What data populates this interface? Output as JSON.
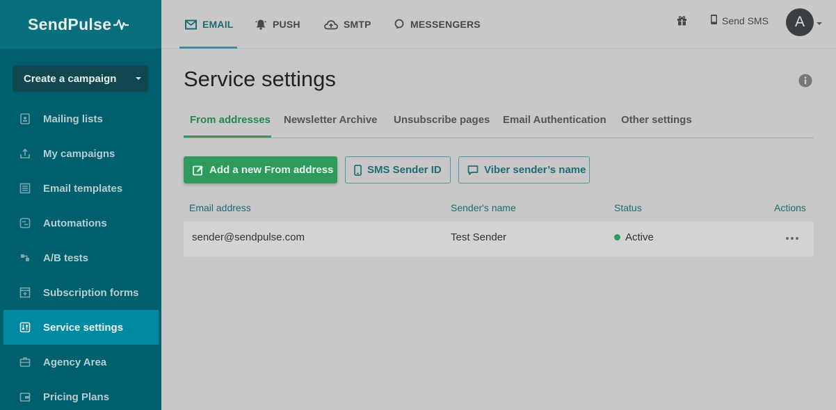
{
  "brand": {
    "name": "SendPulse"
  },
  "sidebar": {
    "create_label": "Create a campaign",
    "items": [
      {
        "label": "Mailing lists",
        "icon": "address-book-icon"
      },
      {
        "label": "My campaigns",
        "icon": "send-tray-icon"
      },
      {
        "label": "Email templates",
        "icon": "template-icon"
      },
      {
        "label": "Automations",
        "icon": "automation-icon"
      },
      {
        "label": "A/B tests",
        "icon": "ab-test-icon"
      },
      {
        "label": "Subscription forms",
        "icon": "form-icon"
      },
      {
        "label": "Service settings",
        "icon": "sliders-icon",
        "active": true
      },
      {
        "label": "Agency Area",
        "icon": "briefcase-icon"
      },
      {
        "label": "Pricing Plans",
        "icon": "wallet-icon"
      }
    ]
  },
  "topnav": {
    "tabs": [
      {
        "label": "EMAIL",
        "icon": "envelope-icon",
        "active": true
      },
      {
        "label": "PUSH",
        "icon": "bell-icon"
      },
      {
        "label": "SMTP",
        "icon": "cloud-upload-icon"
      },
      {
        "label": "MESSENGERS",
        "icon": "chat-bubble-icon"
      }
    ],
    "send_sms_label": "Send SMS",
    "avatar_initial": "A"
  },
  "page": {
    "title": "Service settings",
    "subtabs": [
      {
        "label": "From addresses",
        "active": true
      },
      {
        "label": "Newsletter Archive"
      },
      {
        "label": "Unsubscribe pages"
      },
      {
        "label": "Email Authentication"
      },
      {
        "label": "Other settings"
      }
    ],
    "buttons": {
      "add_from": "Add a new From address",
      "sms_sender": "SMS Sender ID",
      "viber_sender": "Viber sender’s name"
    },
    "table": {
      "headers": [
        "Email address",
        "Sender's name",
        "Status",
        "Actions"
      ],
      "rows": [
        {
          "email": "sender@sendpulse.com",
          "name": "Test Sender",
          "status": "Active"
        }
      ]
    }
  },
  "colors": {
    "sidebar_bg": "#005f6d",
    "active_nav": "#0089a3",
    "primary_green": "#2e9b5d",
    "accent_teal": "#1d6a77"
  }
}
